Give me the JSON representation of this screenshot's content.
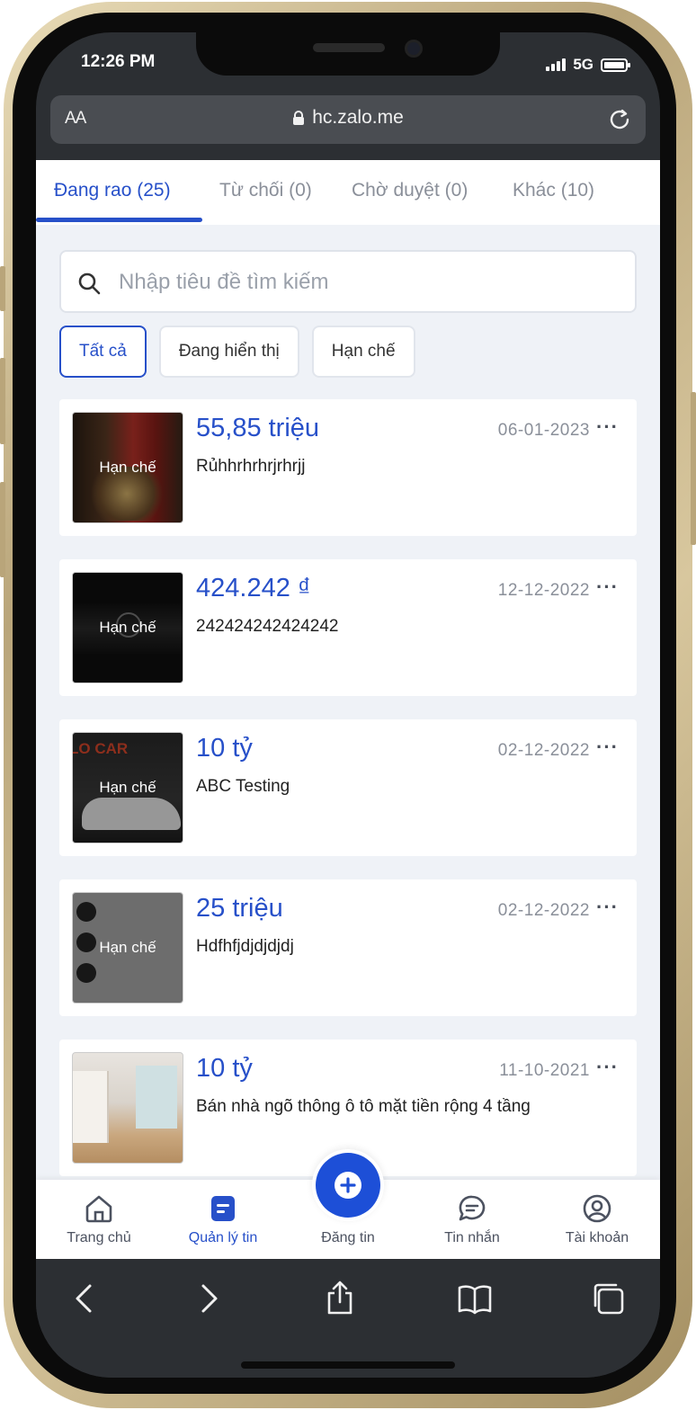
{
  "status": {
    "time": "12:26 PM",
    "network": "5G"
  },
  "browser": {
    "aa": "AA",
    "url": "hc.zalo.me"
  },
  "tabs": [
    {
      "label": "Đang rao (25)"
    },
    {
      "label": "Từ chối (0)"
    },
    {
      "label": "Chờ duyệt (0)"
    },
    {
      "label": "Khác (10)"
    }
  ],
  "search": {
    "placeholder": "Nhập tiêu đề tìm kiếm"
  },
  "filters": [
    {
      "label": "Tất cả"
    },
    {
      "label": "Đang hiển thị"
    },
    {
      "label": "Hạn chế"
    }
  ],
  "listings": [
    {
      "price": "55,85 triệu",
      "title": "Rủhhrhrhrjrhrjj",
      "date": "06-01-2023",
      "status": "Hạn chế",
      "more": "···"
    },
    {
      "price": "424.242 ₫",
      "title": "242424242424242",
      "date": "12-12-2022",
      "status": "Hạn chế",
      "more": "···"
    },
    {
      "price": "10 tỷ",
      "title": "ABC Testing",
      "date": "02-12-2022",
      "status": "Hạn chế",
      "more": "···"
    },
    {
      "price": "25 triệu",
      "title": "Hdfhfjdjdjdjdj",
      "date": "02-12-2022",
      "status": "Hạn chế",
      "more": "···"
    },
    {
      "price": "10 tỷ",
      "title": "Bán nhà ngõ thông ô tô mặt tiền rộng 4 tầng",
      "date": "11-10-2021",
      "status": "",
      "more": "···"
    }
  ],
  "bottom_nav": [
    {
      "label": "Trang chủ"
    },
    {
      "label": "Quản lý tin"
    },
    {
      "label": "Đăng tin"
    },
    {
      "label": "Tin nhắn"
    },
    {
      "label": "Tài khoản"
    }
  ],
  "colors": {
    "accent": "#2750c9",
    "post_button": "#1d4fd7",
    "background": "#eff2f7"
  }
}
